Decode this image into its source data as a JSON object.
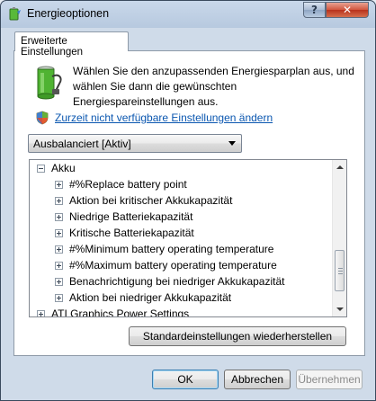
{
  "window": {
    "title": "Energieoptionen",
    "help_glyph": "?",
    "close_glyph": "✕"
  },
  "tab": {
    "label": "Erweiterte Einstellungen"
  },
  "intro": {
    "line1": "Wählen Sie den anzupassenden Energiesparplan aus, und",
    "line2": "wählen Sie dann die gewünschten",
    "line3": "Energiespareinstellungen aus.",
    "link": "Zurzeit nicht verfügbare Einstellungen ändern"
  },
  "plan_select": {
    "value": "Ausbalanciert [Aktiv]"
  },
  "tree": {
    "items": [
      {
        "label": "Akku",
        "expanded": true,
        "level": 0
      },
      {
        "label": "#%Replace battery point",
        "expanded": false,
        "level": 1
      },
      {
        "label": "Aktion bei kritischer Akkukapazität",
        "expanded": false,
        "level": 1
      },
      {
        "label": "Niedrige Batteriekapazität",
        "expanded": false,
        "level": 1
      },
      {
        "label": "Kritische Batteriekapazität",
        "expanded": false,
        "level": 1
      },
      {
        "label": "#%Minimum battery operating temperature",
        "expanded": false,
        "level": 1
      },
      {
        "label": "#%Maximum battery operating temperature",
        "expanded": false,
        "level": 1
      },
      {
        "label": "Benachrichtigung bei niedriger Akkukapazität",
        "expanded": false,
        "level": 1
      },
      {
        "label": "Aktion bei niedriger Akkukapazität",
        "expanded": false,
        "level": 1
      },
      {
        "label": "ATI Graphics Power Settings",
        "expanded": false,
        "level": 0
      }
    ]
  },
  "buttons": {
    "restore": "Standardeinstellungen wiederherstellen",
    "ok": "OK",
    "cancel": "Abbrechen",
    "apply": "Übernehmen"
  },
  "colors": {
    "link": "#0b57b0",
    "titlebar": "#b7c9df",
    "close": "#c7432a"
  }
}
